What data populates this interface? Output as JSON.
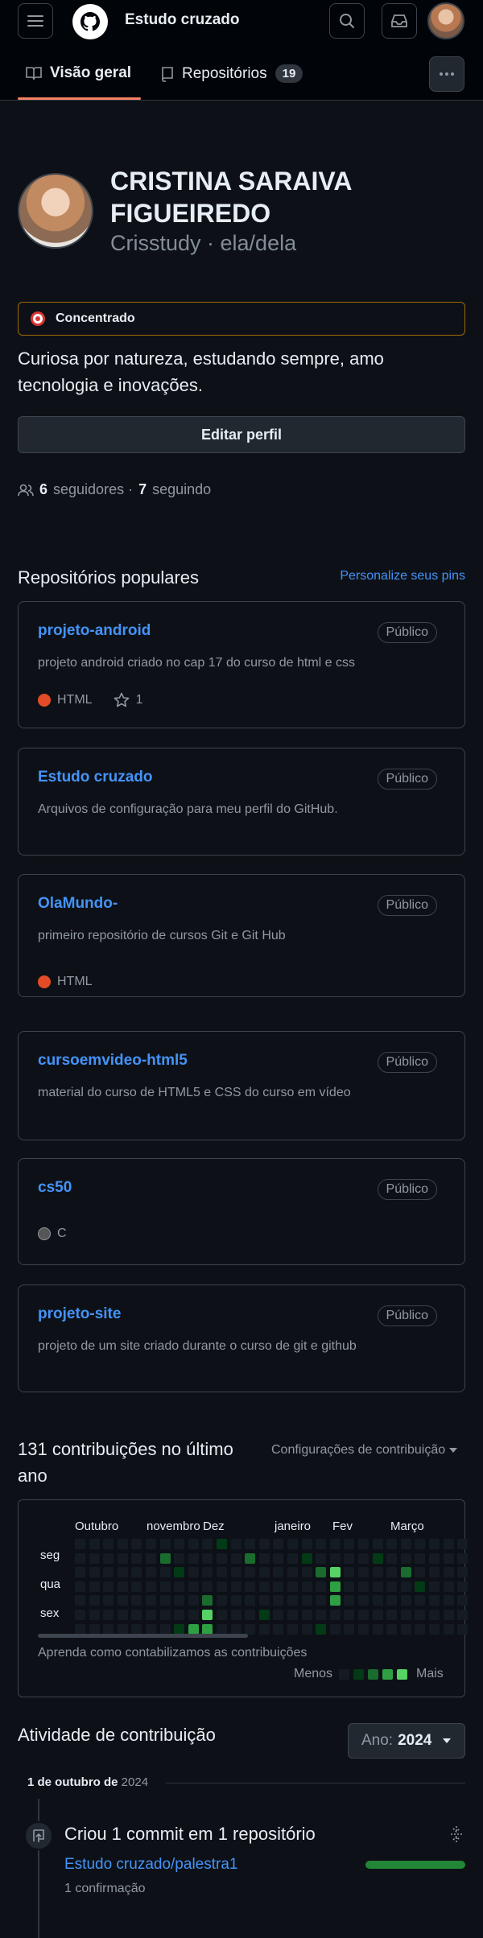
{
  "header": {
    "title": "Estudo cruzado",
    "tabs": [
      {
        "label": "Visão geral"
      },
      {
        "label": "Repositórios",
        "count": "19"
      }
    ]
  },
  "profile": {
    "name_line1": "CRISTINA SARAIVA",
    "name_line2": "FIGUEIREDO",
    "handle": "Crisstudy · ela/dela",
    "status": "Concentrado",
    "bio_line1": "Curiosa por natureza, estudando sempre, amo",
    "bio_line2": "tecnologia e inovações.",
    "edit_button": "Editar perfil",
    "followers_count": "6",
    "followers_label": "seguidores ·",
    "following_count": "7",
    "following_label": "seguindo"
  },
  "popular": {
    "title": "Repositórios populares",
    "customize_link": "Personalize seus pins",
    "repos": [
      {
        "name": "projeto-android",
        "visibility": "Público",
        "description": "projeto android criado no cap 17 do curso de html e css",
        "language": "HTML",
        "stars": "1"
      },
      {
        "name": "Estudo cruzado",
        "visibility": "Público",
        "description": "Arquivos de configuração para meu perfil do GitHub."
      },
      {
        "name": "OlaMundo-",
        "visibility": "Público",
        "description": "primeiro repositório de cursos Git e Git Hub",
        "language": "HTML"
      },
      {
        "name": "cursoemvideo-html5",
        "visibility": "Público",
        "description": "material do curso de HTML5 e CSS do curso em vídeo"
      },
      {
        "name": "cs50",
        "visibility": "Público",
        "language": "C"
      },
      {
        "name": "projeto-site",
        "visibility": "Público",
        "description": "projeto de um site criado durante o curso de git e github"
      }
    ]
  },
  "contributions": {
    "title_line1": "131 contribuições no último",
    "title_line2": "ano",
    "settings": "Configurações de contribuição",
    "months": [
      "Outubro",
      "novembro",
      "Dez",
      "janeiro",
      "Fev",
      "Março"
    ],
    "days": [
      "seg",
      "qua",
      "sex"
    ],
    "learn_link": "Aprenda como contabilizamos as contribuições",
    "less": "Menos",
    "more": "Mais",
    "colors": {
      "empty": "#151b23",
      "l1": "#033a16",
      "l2": "#196c2e",
      "l3": "#2ea043",
      "l4": "#56d364"
    }
  },
  "activity": {
    "title": "Atividade de contribuição",
    "year_label": "Ano:",
    "year": "2024",
    "date_bold": "1 de outubro de",
    "date_year": "2024",
    "summary": "Criou 1 commit em 1 repositório",
    "repo": "Estudo cruzado/palestra1",
    "commits": "1 confirmação"
  }
}
